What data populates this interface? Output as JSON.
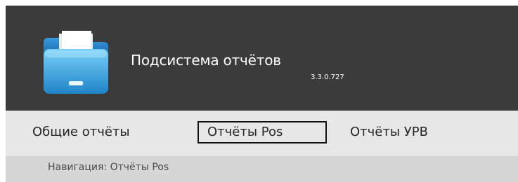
{
  "app": {
    "title": "Подсистема отчётов",
    "version": "3.3.0.727",
    "logo_icon": "folder-icon"
  },
  "menu": {
    "items": [
      {
        "label": "Общие отчёты",
        "selected": false
      },
      {
        "label": "Отчёты Pos",
        "selected": true
      },
      {
        "label": "Отчёты УРВ",
        "selected": false
      }
    ]
  },
  "navigation": {
    "text": "Навигация: Отчёты Pos"
  },
  "colors": {
    "header_bg": "#3b3b3b",
    "menu_bg": "#e7e7e7",
    "nav_bg": "#d6d6d6",
    "folder_blue": "#38a0e0"
  }
}
